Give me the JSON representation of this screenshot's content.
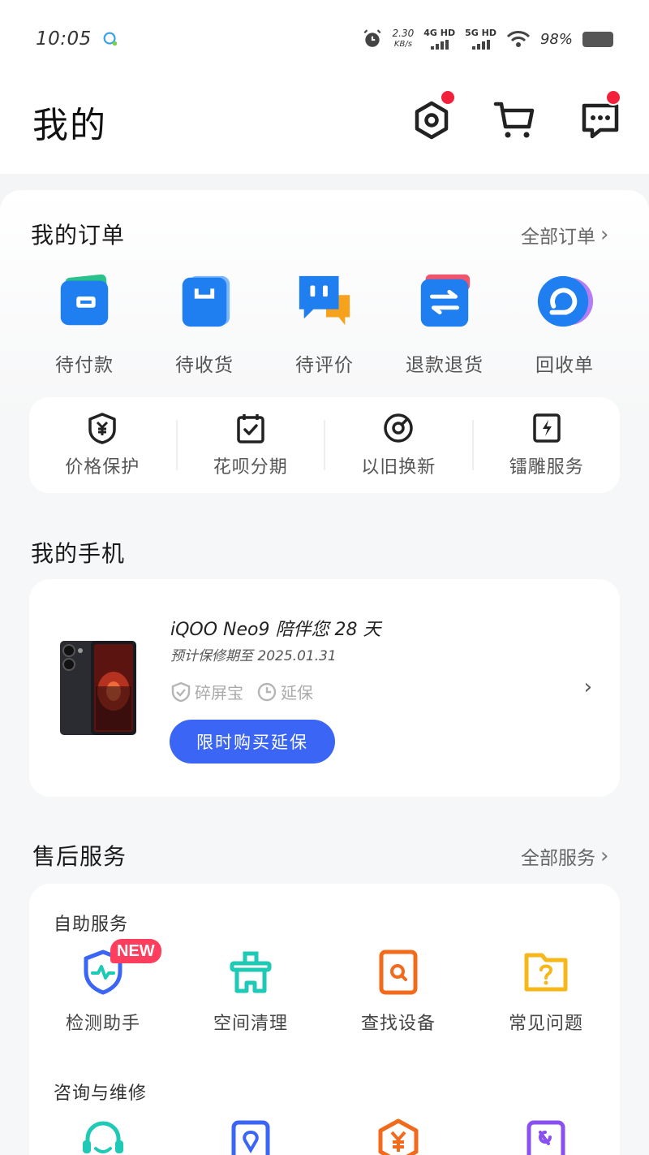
{
  "status_bar": {
    "time": "10:05",
    "net_speed": "2.30",
    "net_unit": "KB/s",
    "sim1": "4G HD",
    "sim2": "5G HD",
    "battery": "98%"
  },
  "header": {
    "title": "我的",
    "icons": [
      "settings-icon",
      "cart-icon",
      "message-icon"
    ]
  },
  "orders": {
    "title": "我的订单",
    "all_link": "全部订单",
    "items": [
      {
        "label": "待付款",
        "icon": "wallet-icon"
      },
      {
        "label": "待收货",
        "icon": "bag-icon"
      },
      {
        "label": "待评价",
        "icon": "comment-icon"
      },
      {
        "label": "退款退货",
        "icon": "refund-icon"
      },
      {
        "label": "回收单",
        "icon": "recycle-icon"
      }
    ]
  },
  "quick_services": [
    {
      "label": "价格保护",
      "icon": "price-shield-icon"
    },
    {
      "label": "花呗分期",
      "icon": "calendar-check-icon"
    },
    {
      "label": "以旧换新",
      "icon": "trade-in-icon"
    },
    {
      "label": "镭雕服务",
      "icon": "laser-icon"
    }
  ],
  "my_phone": {
    "title": "我的手机",
    "device_line": "iQOO Neo9 陪伴您 28 天",
    "warranty_line": "预计保修期至 2025.01.31",
    "tags": [
      "碎屏宝",
      "延保"
    ],
    "button": "限时购买延保"
  },
  "after_sales": {
    "title": "售后服务",
    "all_link": "全部服务",
    "self_service": {
      "title": "自助服务",
      "items": [
        {
          "label": "检测助手",
          "icon": "detect-shield-icon",
          "badge": "NEW"
        },
        {
          "label": "空间清理",
          "icon": "clean-icon"
        },
        {
          "label": "查找设备",
          "icon": "find-device-icon"
        },
        {
          "label": "常见问题",
          "icon": "faq-folder-icon"
        }
      ]
    },
    "consult_repair": {
      "title": "咨询与维修",
      "items": [
        {
          "icon": "headset-icon"
        },
        {
          "icon": "location-icon"
        },
        {
          "icon": "price-icon"
        },
        {
          "icon": "repair-icon"
        }
      ]
    }
  },
  "colors": {
    "accent": "#3b65f4",
    "badge_red": "#f2203a",
    "new_badge": "#ff3d5c",
    "teal": "#1ec9b5",
    "orange": "#f26a1b",
    "yellow": "#f5b71a",
    "purple": "#8a4ff0"
  }
}
